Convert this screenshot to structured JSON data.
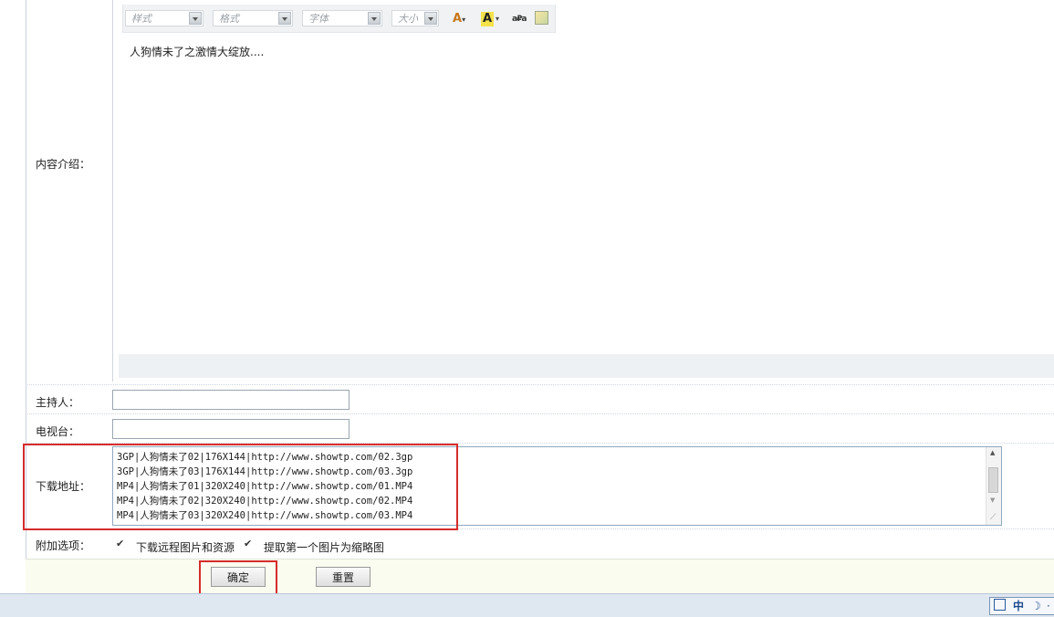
{
  "toolbar": {
    "style_placeholder": "样式",
    "format_placeholder": "格式",
    "font_placeholder": "字体",
    "size_placeholder": "大小"
  },
  "editor": {
    "content": "人狗情未了之激情大绽放...."
  },
  "labels": {
    "content_intro": "内容介绍：",
    "host": "主持人：",
    "tv_station": "电视台：",
    "download_url": "下载地址：",
    "extra_options": "附加选项："
  },
  "fields": {
    "host_value": "",
    "tv_value": ""
  },
  "download_lines": [
    "3GP|人狗情未了02|176X144|http://www.showtp.com/02.3gp",
    "3GP|人狗情未了03|176X144|http://www.showtp.com/03.3gp",
    "MP4|人狗情未了01|320X240|http://www.showtp.com/01.MP4",
    "MP4|人狗情未了02|320X240|http://www.showtp.com/02.MP4",
    "MP4|人狗情未了03|320X240|http://www.showtp.com/03.MP4"
  ],
  "options": {
    "download_remote": "下载远程图片和资源",
    "first_thumb": "提取第一个图片为缩略图",
    "download_remote_checked": true,
    "first_thumb_checked": true
  },
  "buttons": {
    "confirm": "确定",
    "reset": "重置"
  },
  "ime": {
    "lang": "中"
  },
  "colors": {
    "highlight_border": "#d62c2c"
  }
}
